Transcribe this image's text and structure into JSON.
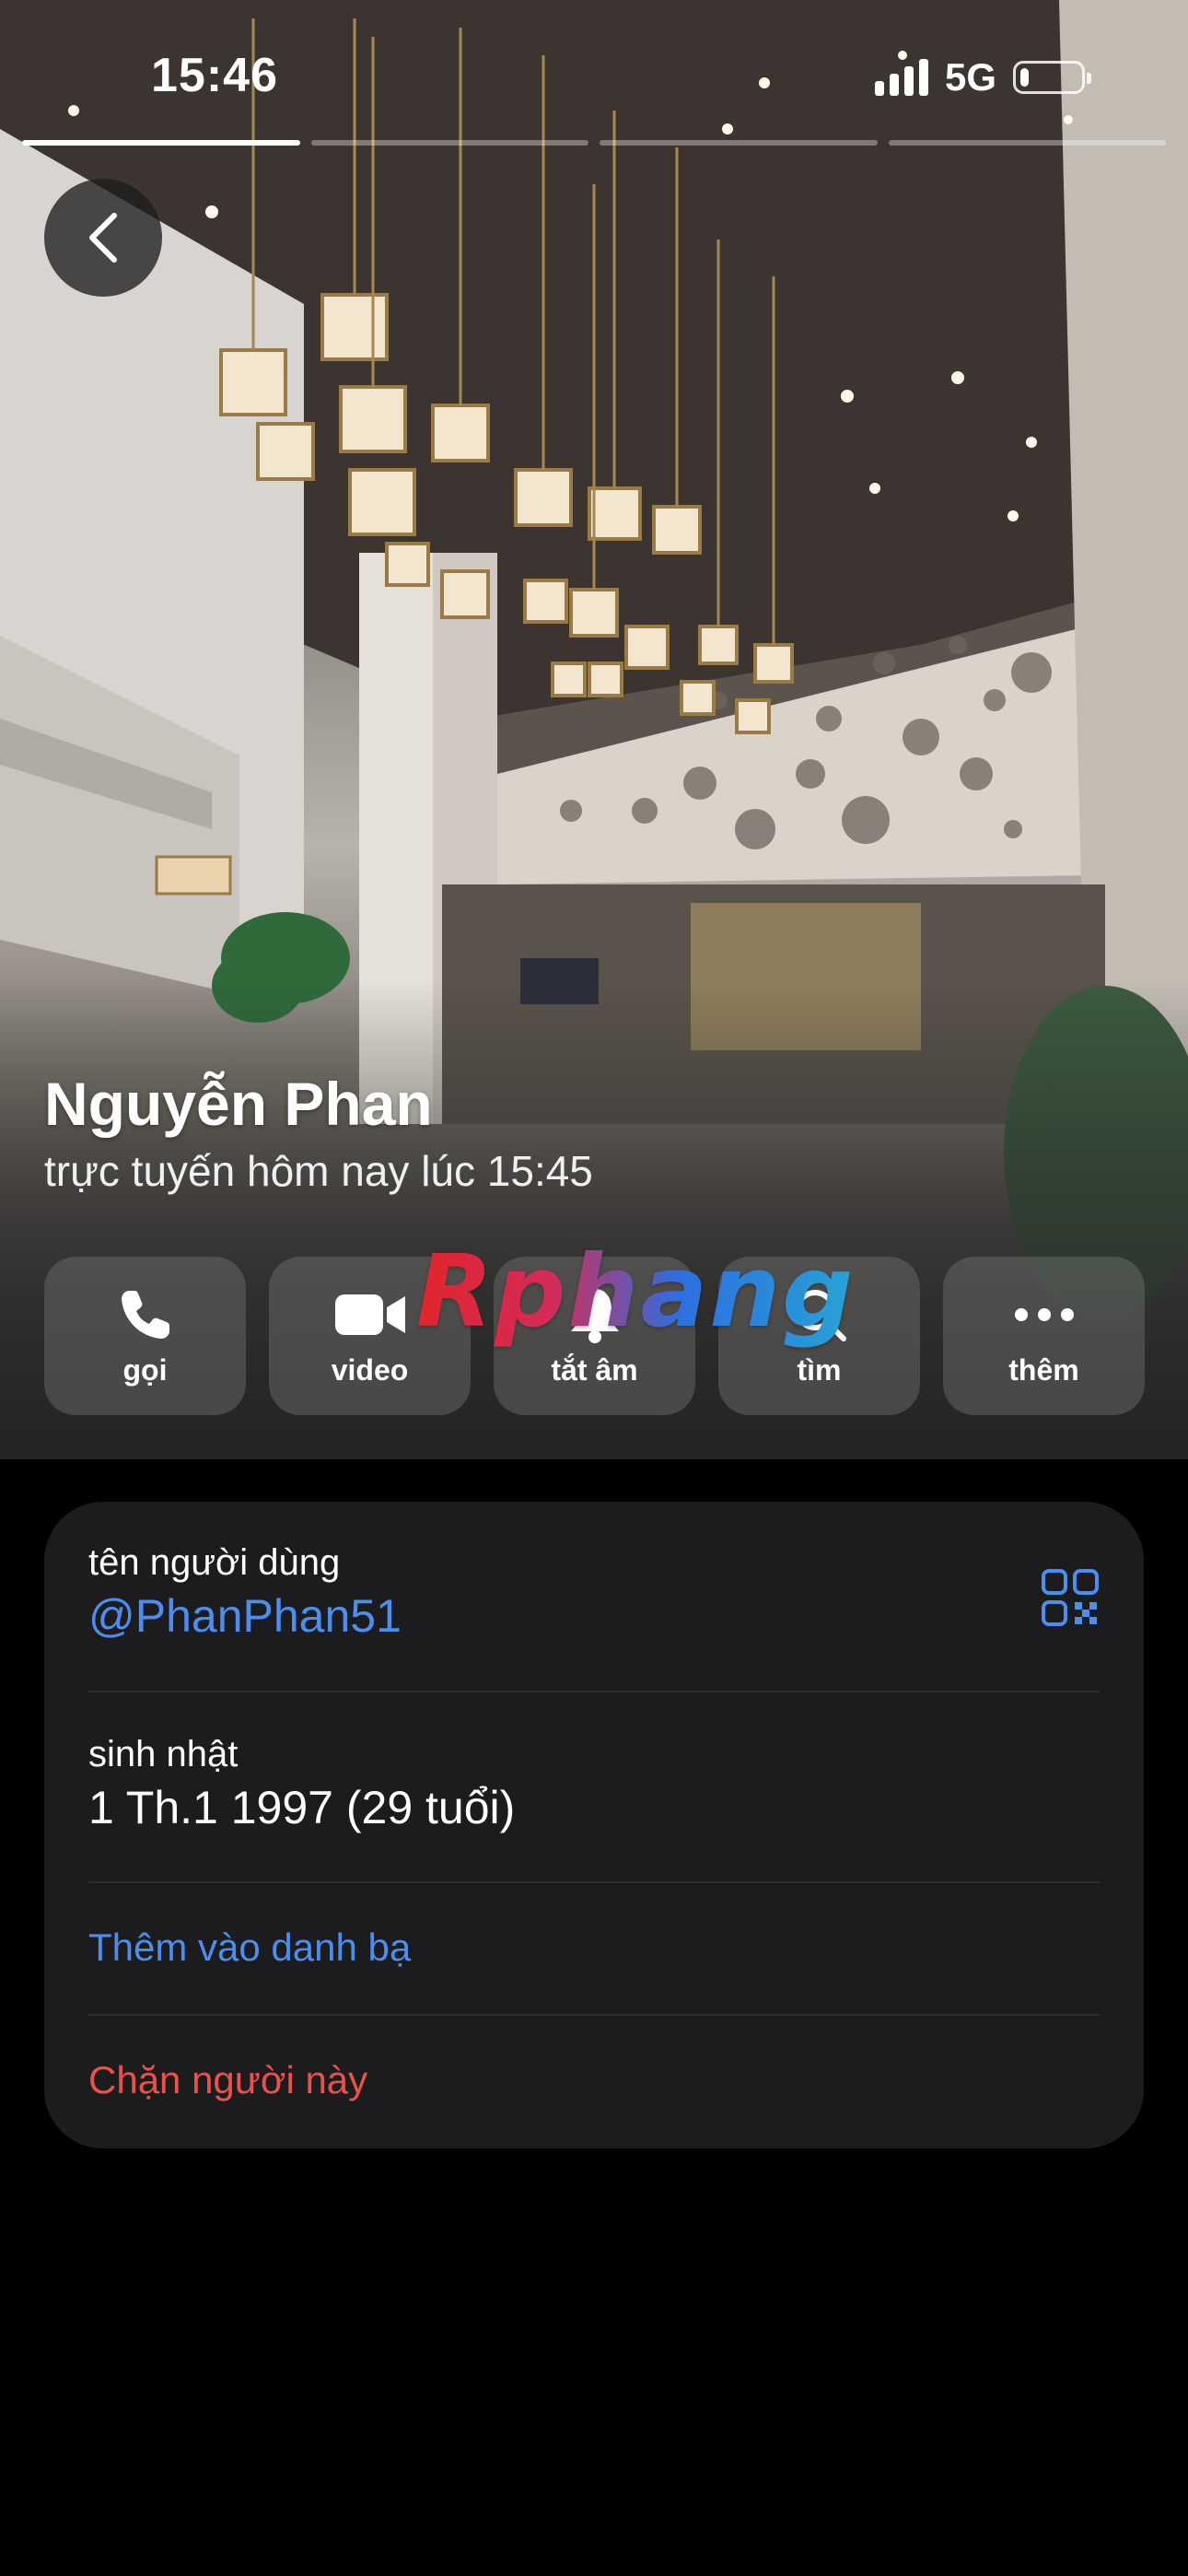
{
  "status_bar": {
    "time": "15:46",
    "network": "5G",
    "battery_level": 0.15
  },
  "stories": {
    "count": 4,
    "active_index": 0
  },
  "profile": {
    "name": "Nguyễn Phan",
    "last_seen": "trực tuyến hôm nay lúc 15:45"
  },
  "actions": [
    {
      "label": "gọi",
      "icon": "phone-icon"
    },
    {
      "label": "video",
      "icon": "video-camera-icon"
    },
    {
      "label": "tắt âm",
      "icon": "bell-icon"
    },
    {
      "label": "tìm",
      "icon": "search-icon"
    },
    {
      "label": "thêm",
      "icon": "more-icon"
    }
  ],
  "watermark": "Rphang",
  "info": {
    "username_label": "tên người dùng",
    "username": "@PhanPhan51",
    "birthday_label": "sinh nhật",
    "birthday": "1 Th.1 1997 (29 tuổi)",
    "add_contact": "Thêm vào danh bạ",
    "block": "Chặn người này"
  },
  "colors": {
    "link": "#4a8ff0",
    "danger": "#eb5146",
    "card": "#1c1c1e"
  }
}
